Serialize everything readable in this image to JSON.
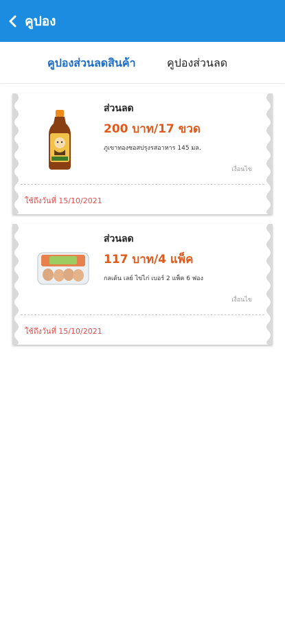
{
  "header": {
    "title": "คูปอง"
  },
  "tabs": [
    {
      "label": "คูปองส่วนลดสินค้า",
      "active": true
    },
    {
      "label": "คูปองส่วนลด",
      "active": false
    }
  ],
  "coupons": [
    {
      "type_label": "ส่วนลด",
      "price": "200 บาท/17 ขวด",
      "description": "ภูเขาทองซอสปรุงรสอาหาร 145 มล.",
      "conditions_label": "เงื่อนไข",
      "expiry": "ใช้ถึงวันที่ 15/10/2021",
      "image": "sauce-bottle"
    },
    {
      "type_label": "ส่วนลด",
      "price": "117 บาท/4 แพ็ค",
      "description": "กลเด้น เลย์ ไข่ไก่ เบอร์ 2 แพ็ค 6 ฟอง",
      "conditions_label": "เงื่อนไข",
      "expiry": "ใช้ถึงวันที่ 15/10/2021",
      "image": "egg-pack"
    }
  ],
  "colors": {
    "header": "#1b8ce0",
    "active_tab": "#1b6cc7",
    "price": "#e05a1c",
    "expiry": "#e44a4a"
  }
}
